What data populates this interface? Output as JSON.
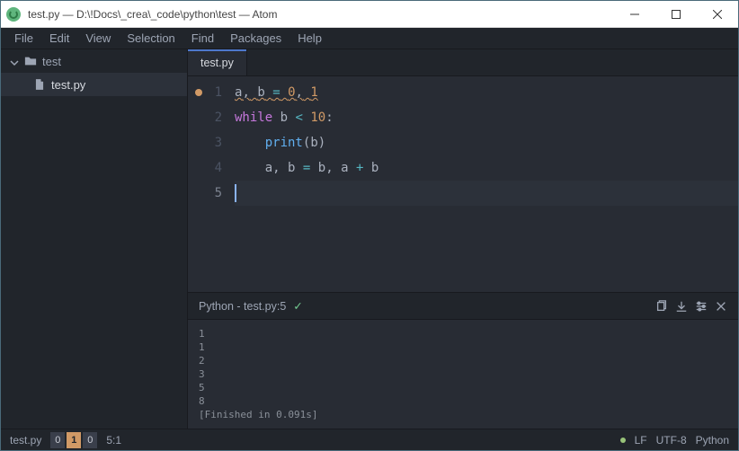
{
  "window": {
    "title": "test.py — D:\\!Docs\\_crea\\_code\\python\\test — Atom"
  },
  "menu": [
    "File",
    "Edit",
    "View",
    "Selection",
    "Find",
    "Packages",
    "Help"
  ],
  "tree": {
    "root": "test",
    "items": [
      "test.py"
    ]
  },
  "tabs": [
    "test.py"
  ],
  "editor": {
    "line_numbers": [
      "1",
      "2",
      "3",
      "4",
      "5"
    ],
    "current_line_index": 4,
    "modified_dot_line_index": 0,
    "tokens": {
      "l1": {
        "a": "a",
        "c": ",",
        "sp": " ",
        "b": "b",
        "eq": "=",
        "z": "0",
        "o": "1"
      },
      "l2": {
        "while": "while",
        "b": "b",
        "lt": "<",
        "ten": "10",
        "colon": ":"
      },
      "l3": {
        "print": "print",
        "lp": "(",
        "b": "b",
        "rp": ")"
      },
      "l4": {
        "a": "a",
        "c": ",",
        "b": "b",
        "eq": "=",
        "plus": "+"
      }
    }
  },
  "panel": {
    "title": "Python - test.py:5",
    "output": "1\n1\n2\n3\n5\n8\n[Finished in 0.091s]"
  },
  "status": {
    "filename": "test.py",
    "git": {
      "behind": "0",
      "modified": "1",
      "ahead": "0"
    },
    "cursor": "5:1",
    "line_ending": "LF",
    "encoding": "UTF-8",
    "grammar": "Python"
  }
}
